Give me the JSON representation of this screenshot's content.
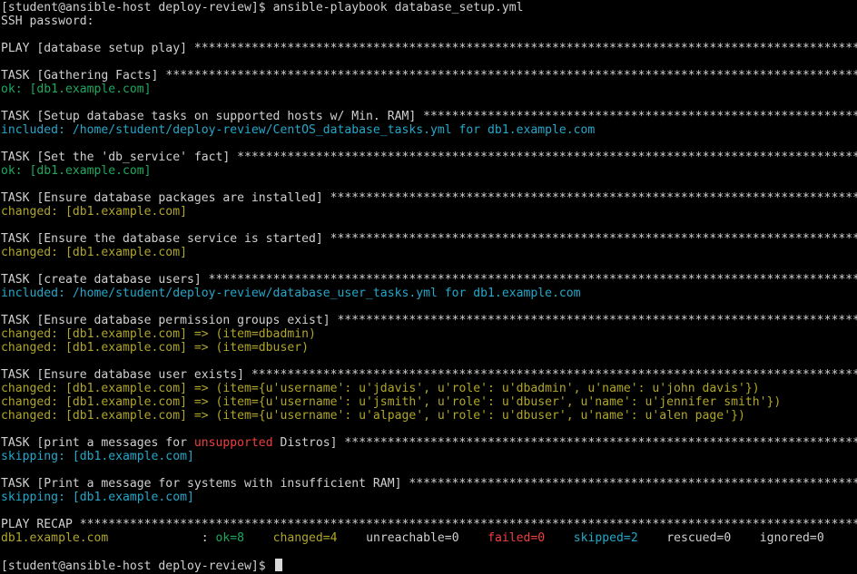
{
  "terminal": {
    "command_line": {
      "prompt": "[student@ansible-host deploy-review]$ ",
      "command": "ansible-playbook database_setup.yml"
    },
    "ssh_prompt": "SSH password:",
    "play_header": "PLAY [database setup play] ",
    "tasks": [
      {
        "header": "TASK [Gathering Facts] ",
        "results": [
          {
            "text": "ok: [db1.example.com]",
            "status": "ok"
          }
        ]
      },
      {
        "header": "TASK [Setup database tasks on supported hosts w/ Min. RAM] ",
        "results": [
          {
            "text": "included: /home/student/deploy-review/CentOS_database_tasks.yml for db1.example.com",
            "status": "included"
          }
        ]
      },
      {
        "header": "TASK [Set the 'db_service' fact] ",
        "results": [
          {
            "text": "ok: [db1.example.com]",
            "status": "ok"
          }
        ]
      },
      {
        "header": "TASK [Ensure database packages are installed] ",
        "results": [
          {
            "text": "changed: [db1.example.com]",
            "status": "changed"
          }
        ]
      },
      {
        "header": "TASK [Ensure the database service is started] ",
        "results": [
          {
            "text": "changed: [db1.example.com]",
            "status": "changed"
          }
        ]
      },
      {
        "header": "TASK [create database users] ",
        "results": [
          {
            "text": "included: /home/student/deploy-review/database_user_tasks.yml for db1.example.com",
            "status": "included"
          }
        ]
      },
      {
        "header": "TASK [Ensure database permission groups exist] ",
        "results": [
          {
            "text": "changed: [db1.example.com] => (item=dbadmin)",
            "status": "changed"
          },
          {
            "text": "changed: [db1.example.com] => (item=dbuser)",
            "status": "changed"
          }
        ]
      },
      {
        "header": "TASK [Ensure database user exists] ",
        "results": [
          {
            "text": "changed: [db1.example.com] => (item={u'username': u'jdavis', u'role': u'dbadmin', u'name': u'john davis'})",
            "status": "changed"
          },
          {
            "text": "changed: [db1.example.com] => (item={u'username': u'jsmith', u'role': u'dbuser', u'name': u'jennifer smith'})",
            "status": "changed"
          },
          {
            "text": "changed: [db1.example.com] => (item={u'username': u'alpage', u'role': u'dbuser', u'name': u'alen page'})",
            "status": "changed"
          }
        ]
      },
      {
        "header_pre": "TASK [print a messages for ",
        "header_highlight": "unsupported",
        "header_post": " Distros] ",
        "results": [
          {
            "text": "skipping: [db1.example.com]",
            "status": "skipped"
          }
        ]
      },
      {
        "header": "TASK [Print a message for systems with insufficient RAM] ",
        "results": [
          {
            "text": "skipping: [db1.example.com]",
            "status": "skipped"
          }
        ]
      }
    ],
    "recap": {
      "header": "PLAY RECAP ",
      "host": "db1.example.com",
      "separator": "             : ",
      "ok": "ok=8",
      "changed": "changed=4",
      "unreachable": "unreachable=0",
      "failed": "failed=0",
      "skipped": "skipped=2",
      "rescued": "rescued=0",
      "ignored": "ignored=0"
    },
    "final_prompt": "[student@ansible-host deploy-review]$ ",
    "colors": {
      "background": "#000000",
      "default_text": "#d0d0d0",
      "ok": "#1fa85f",
      "changed": "#b0a62a",
      "included": "#25a7c9",
      "skipped": "#25a7c9",
      "failed": "#ef3f3f"
    }
  }
}
